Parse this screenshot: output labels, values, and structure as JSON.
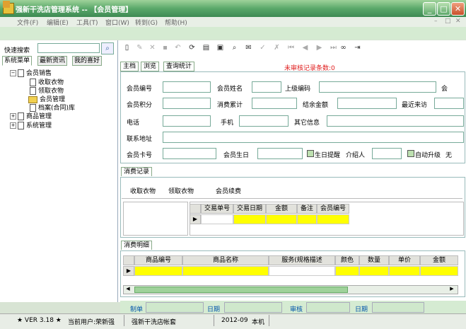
{
  "window": {
    "title": "强新干洗店管理系统 -- 【会员管理】"
  },
  "menu": [
    "文件(F)",
    "编辑(E)",
    "工具(T)",
    "窗口(W)",
    "转到(G)",
    "帮助(H)"
  ],
  "left_panel": {
    "quick_search_label": "快速搜索",
    "tabs": [
      "系统菜单",
      "最新资讯",
      "我的喜好"
    ],
    "tree": {
      "member_sales": "会员销售",
      "receive_clothes": "收取衣物",
      "pickup_clothes": "领取衣物",
      "member_manage": "会员管理",
      "archive": "档案(合同)库",
      "goods_manage": "商品管理",
      "system_manage": "系统管理"
    }
  },
  "main": {
    "tabs": [
      "主档",
      "浏览",
      "查询统计"
    ],
    "unaudited_label": "未审核记录条数:0",
    "form": {
      "member_no": "会员编号",
      "member_name": "会员姓名",
      "superior_code": "上级编码",
      "trailing_hui": "会",
      "member_points": "会员积分",
      "consume_total": "消费累计",
      "balance": "结余金额",
      "last_visit": "最近来访",
      "phone": "电话",
      "mobile": "手机",
      "other_info": "其它信息",
      "address": "联系地址",
      "card_no": "会员卡号",
      "birthday": "会员生日",
      "birthday_remind": "生日提醒",
      "referrer": "介绍人",
      "auto_upgrade": "自动升级",
      "trailing_no": "无"
    },
    "consume_record": {
      "tab": "消费记录",
      "links": [
        "收取衣物",
        "领取衣物",
        "会员续费"
      ],
      "columns": [
        "交易单号",
        "交易日期",
        "金额",
        "备注",
        "会员编号"
      ]
    },
    "consume_detail": {
      "tab": "消费明细",
      "columns": [
        "商品编号",
        "商品名称",
        "服务(规格描述",
        "颜色",
        "数量",
        "单价",
        "金额"
      ]
    },
    "audit": {
      "maker": "制单",
      "date1": "日期",
      "auditor": "审核",
      "date2": "日期"
    }
  },
  "status": {
    "version": "★ VER 3.18 ★",
    "user": "当前用户:荣新强",
    "account": "强新干洗店帐套",
    "date": "2012-09",
    "host": "本机"
  }
}
